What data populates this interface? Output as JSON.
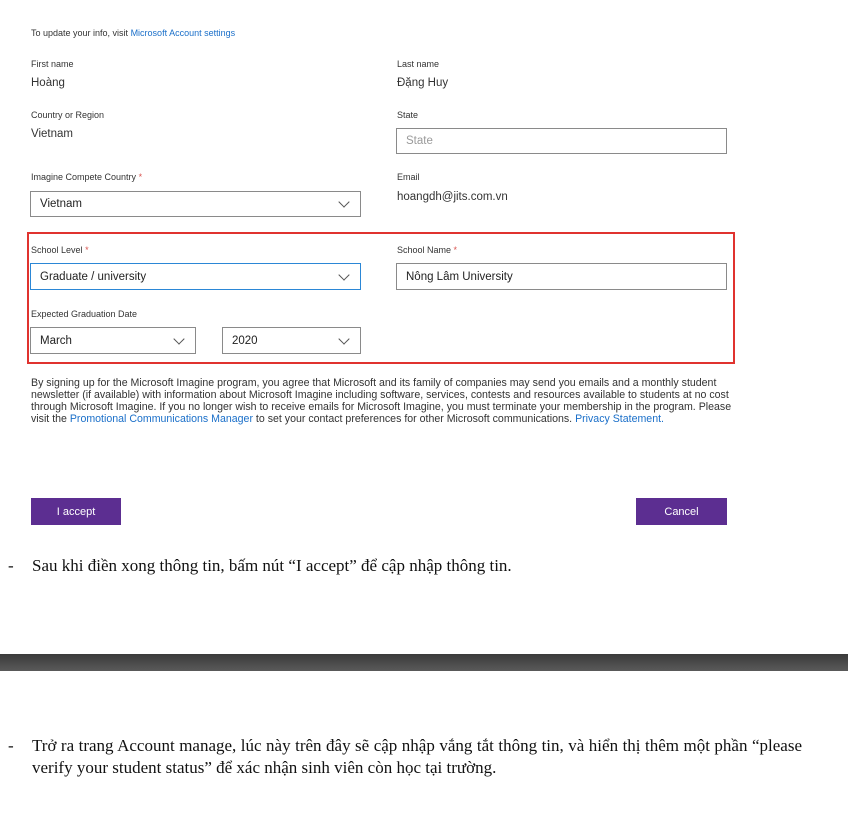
{
  "header": {
    "prefix": "To update your info, visit ",
    "link": "Microsoft Account settings"
  },
  "fields": {
    "first_name": {
      "label": "First name",
      "value": "Hoàng"
    },
    "last_name": {
      "label": "Last name",
      "value": "Đặng Huy"
    },
    "country": {
      "label": "Country or Region",
      "value": "Vietnam"
    },
    "state": {
      "label": "State",
      "placeholder": "State"
    },
    "compete_country": {
      "label": "Imagine Compete Country",
      "required": "*",
      "value": "Vietnam"
    },
    "email": {
      "label": "Email",
      "value": "hoangdh@jits.com.vn"
    },
    "school_level": {
      "label": "School Level",
      "required": "*",
      "value": "Graduate / university"
    },
    "school_name": {
      "label": "School Name",
      "required": "*",
      "value": "Nông Lâm University"
    },
    "graduation": {
      "label": "Expected Graduation Date",
      "month": "March",
      "year": "2020"
    }
  },
  "consent": {
    "text1": "By signing up for the Microsoft Imagine program, you agree that Microsoft and its family of companies may send you emails and a monthly student newsletter (if available) with information about Microsoft Imagine including software, services, contests and resources available to students at no cost through Microsoft Imagine. If you no longer wish to receive emails for Microsoft Imagine, you must terminate your membership in the program. Please visit the ",
    "link1": "Promotional Communications Manager",
    "text2": " to set your contact preferences for other Microsoft communications. ",
    "link2": "Privacy Statement."
  },
  "buttons": {
    "accept": "I accept",
    "cancel": "Cancel"
  },
  "instructions": {
    "dash": "-",
    "step1": "Sau khi điền xong thông tin, bấm nút “I accept” để cập nhập thông tin.",
    "step2": "Trở ra trang Account manage, lúc này trên đây sẽ cập nhập vắng tắt thông tin, và hiển thị thêm một phần “please verify your student status” để xác nhận sinh viên còn học tại trường."
  },
  "colors": {
    "accent": "#5c2e91",
    "link": "#1a6fc9",
    "highlight": "#e0332f",
    "focus": "#2b87d6"
  }
}
